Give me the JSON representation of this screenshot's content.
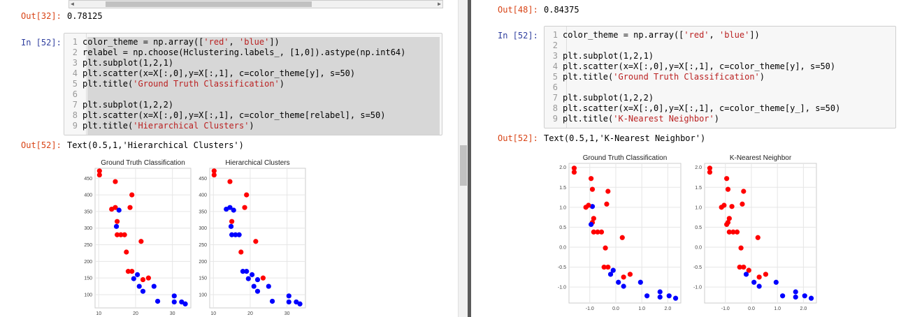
{
  "left": {
    "out32": {
      "prompt": "Out[32]:",
      "value": "0.78125"
    },
    "in52": {
      "prompt": "In [52]:",
      "lines": [
        {
          "n": "1",
          "code": "color_theme = np.array(['red', 'blue'])"
        },
        {
          "n": "2",
          "code": "relabel = np.choose(Hclustering.labels_, [1,0]).astype(np.int64)"
        },
        {
          "n": "3",
          "code": "plt.subplot(1,2,1)"
        },
        {
          "n": "4",
          "code": "plt.scatter(x=X[:,0],y=X[:,1], c=color_theme[y], s=50)"
        },
        {
          "n": "5",
          "code": "plt.title('Ground Truth Classification')"
        },
        {
          "n": "6",
          "code": ""
        },
        {
          "n": "7",
          "code": "plt.subplot(1,2,2)"
        },
        {
          "n": "8",
          "code": "plt.scatter(x=X[:,0],y=X[:,1], c=color_theme[relabel], s=50)"
        },
        {
          "n": "9",
          "code": "plt.title('Hierarchical Clusters')"
        }
      ]
    },
    "out52": {
      "prompt": "Out[52]:",
      "value": "Text(0.5,1,'Hierarchical Clusters')"
    }
  },
  "right": {
    "out48": {
      "prompt": "Out[48]:",
      "value": "0.84375"
    },
    "in52": {
      "prompt": "In [52]:",
      "lines": [
        {
          "n": "1",
          "code": "color_theme = np.array(['red', 'blue'])"
        },
        {
          "n": "2",
          "code": ""
        },
        {
          "n": "3",
          "code": "plt.subplot(1,2,1)"
        },
        {
          "n": "4",
          "code": "plt.scatter(x=X[:,0],y=X[:,1], c=color_theme[y], s=50)"
        },
        {
          "n": "5",
          "code": "plt.title('Ground Truth Classification')"
        },
        {
          "n": "6",
          "code": ""
        },
        {
          "n": "7",
          "code": "plt.subplot(1,2,2)"
        },
        {
          "n": "8",
          "code": "plt.scatter(x=X[:,0],y=X[:,1], c=color_theme[y_], s=50)"
        },
        {
          "n": "9",
          "code": "plt.title('K-Nearest Neighbor')"
        }
      ]
    },
    "out52": {
      "prompt": "Out[52]:",
      "value": "Text(0.5,1,'K-Nearest Neighbor')"
    }
  },
  "colors": {
    "red": "#ff0000",
    "blue": "#0000ff",
    "grid": "#e6e6e6"
  },
  "chart_data": [
    {
      "type": "scatter",
      "title": "Ground Truth Classification",
      "xlim": [
        9,
        35
      ],
      "ylim": [
        60,
        480
      ],
      "xticks": [
        10,
        20,
        30
      ],
      "yticks": [
        100,
        150,
        200,
        250,
        300,
        350,
        400,
        450
      ],
      "grid": true,
      "points": [
        {
          "x": 10.2,
          "y": 472,
          "c": "red"
        },
        {
          "x": 10.2,
          "y": 460,
          "c": "red"
        },
        {
          "x": 14.5,
          "y": 440,
          "c": "red"
        },
        {
          "x": 19,
          "y": 400,
          "c": "red"
        },
        {
          "x": 13.5,
          "y": 357,
          "c": "red"
        },
        {
          "x": 14.5,
          "y": 362,
          "c": "red"
        },
        {
          "x": 18.5,
          "y": 362,
          "c": "red"
        },
        {
          "x": 15.5,
          "y": 354,
          "c": "blue"
        },
        {
          "x": 15,
          "y": 320,
          "c": "red"
        },
        {
          "x": 14.8,
          "y": 305,
          "c": "blue"
        },
        {
          "x": 15,
          "y": 280,
          "c": "red"
        },
        {
          "x": 16,
          "y": 280,
          "c": "red"
        },
        {
          "x": 17,
          "y": 280,
          "c": "red"
        },
        {
          "x": 21.5,
          "y": 260,
          "c": "red"
        },
        {
          "x": 17.5,
          "y": 228,
          "c": "red"
        },
        {
          "x": 18,
          "y": 170,
          "c": "red"
        },
        {
          "x": 19,
          "y": 170,
          "c": "red"
        },
        {
          "x": 19.5,
          "y": 148,
          "c": "blue"
        },
        {
          "x": 20.5,
          "y": 160,
          "c": "blue"
        },
        {
          "x": 22,
          "y": 145,
          "c": "red"
        },
        {
          "x": 23.5,
          "y": 150,
          "c": "red"
        },
        {
          "x": 21,
          "y": 125,
          "c": "blue"
        },
        {
          "x": 22,
          "y": 110,
          "c": "blue"
        },
        {
          "x": 25,
          "y": 125,
          "c": "blue"
        },
        {
          "x": 26,
          "y": 80,
          "c": "blue"
        },
        {
          "x": 30.5,
          "y": 96,
          "c": "blue"
        },
        {
          "x": 30.5,
          "y": 78,
          "c": "blue"
        },
        {
          "x": 32.5,
          "y": 78,
          "c": "blue"
        },
        {
          "x": 33.5,
          "y": 72,
          "c": "blue"
        }
      ]
    },
    {
      "type": "scatter",
      "title": "Hierarchical Clusters",
      "xlim": [
        9,
        35
      ],
      "ylim": [
        60,
        480
      ],
      "xticks": [
        10,
        20,
        30
      ],
      "yticks": [
        100,
        150,
        200,
        250,
        300,
        350,
        400,
        450
      ],
      "grid": true,
      "points": [
        {
          "x": 10.2,
          "y": 472,
          "c": "red"
        },
        {
          "x": 10.2,
          "y": 460,
          "c": "red"
        },
        {
          "x": 14.5,
          "y": 440,
          "c": "red"
        },
        {
          "x": 19,
          "y": 400,
          "c": "red"
        },
        {
          "x": 13.5,
          "y": 357,
          "c": "blue"
        },
        {
          "x": 14.5,
          "y": 362,
          "c": "blue"
        },
        {
          "x": 18.5,
          "y": 362,
          "c": "red"
        },
        {
          "x": 15.5,
          "y": 354,
          "c": "blue"
        },
        {
          "x": 15,
          "y": 320,
          "c": "red"
        },
        {
          "x": 14.8,
          "y": 305,
          "c": "blue"
        },
        {
          "x": 15,
          "y": 280,
          "c": "blue"
        },
        {
          "x": 16,
          "y": 280,
          "c": "blue"
        },
        {
          "x": 17,
          "y": 280,
          "c": "blue"
        },
        {
          "x": 21.5,
          "y": 260,
          "c": "red"
        },
        {
          "x": 17.5,
          "y": 228,
          "c": "red"
        },
        {
          "x": 18,
          "y": 170,
          "c": "blue"
        },
        {
          "x": 19,
          "y": 170,
          "c": "blue"
        },
        {
          "x": 19.5,
          "y": 148,
          "c": "blue"
        },
        {
          "x": 20.5,
          "y": 160,
          "c": "blue"
        },
        {
          "x": 22,
          "y": 145,
          "c": "blue"
        },
        {
          "x": 23.5,
          "y": 150,
          "c": "red"
        },
        {
          "x": 21,
          "y": 125,
          "c": "blue"
        },
        {
          "x": 22,
          "y": 110,
          "c": "blue"
        },
        {
          "x": 25,
          "y": 125,
          "c": "blue"
        },
        {
          "x": 26,
          "y": 80,
          "c": "blue"
        },
        {
          "x": 30.5,
          "y": 96,
          "c": "blue"
        },
        {
          "x": 30.5,
          "y": 78,
          "c": "blue"
        },
        {
          "x": 32.5,
          "y": 78,
          "c": "blue"
        },
        {
          "x": 33.5,
          "y": 72,
          "c": "blue"
        }
      ]
    },
    {
      "type": "scatter",
      "title": "Ground Truth Classification",
      "xlim": [
        -1.8,
        2.5
      ],
      "ylim": [
        -1.4,
        2.1
      ],
      "xticks": [
        -1,
        0,
        1,
        2
      ],
      "yticks": [
        -1.0,
        -0.5,
        0.0,
        0.5,
        1.0,
        1.5,
        2.0
      ],
      "grid": true,
      "points": [
        {
          "x": -1.6,
          "y": 1.98,
          "c": "red"
        },
        {
          "x": -1.6,
          "y": 1.88,
          "c": "red"
        },
        {
          "x": -0.95,
          "y": 1.72,
          "c": "red"
        },
        {
          "x": -0.9,
          "y": 1.02,
          "c": "blue"
        },
        {
          "x": -0.9,
          "y": 1.45,
          "c": "red"
        },
        {
          "x": -0.3,
          "y": 1.4,
          "c": "red"
        },
        {
          "x": -0.35,
          "y": 1.08,
          "c": "red"
        },
        {
          "x": -1.15,
          "y": 1.0,
          "c": "red"
        },
        {
          "x": -1.05,
          "y": 1.05,
          "c": "red"
        },
        {
          "x": -0.85,
          "y": 0.72,
          "c": "red"
        },
        {
          "x": -0.9,
          "y": 0.62,
          "c": "red"
        },
        {
          "x": -0.95,
          "y": 0.57,
          "c": "blue"
        },
        {
          "x": -0.85,
          "y": 0.38,
          "c": "red"
        },
        {
          "x": -0.7,
          "y": 0.38,
          "c": "red"
        },
        {
          "x": -0.55,
          "y": 0.38,
          "c": "red"
        },
        {
          "x": 0.25,
          "y": 0.24,
          "c": "red"
        },
        {
          "x": -0.4,
          "y": -0.02,
          "c": "red"
        },
        {
          "x": -0.45,
          "y": -0.5,
          "c": "red"
        },
        {
          "x": -0.3,
          "y": -0.5,
          "c": "red"
        },
        {
          "x": -0.1,
          "y": -0.58,
          "c": "blue"
        },
        {
          "x": -0.2,
          "y": -0.68,
          "c": "blue"
        },
        {
          "x": 0.3,
          "y": -0.75,
          "c": "red"
        },
        {
          "x": 0.55,
          "y": -0.68,
          "c": "red"
        },
        {
          "x": 0.1,
          "y": -0.88,
          "c": "blue"
        },
        {
          "x": 0.3,
          "y": -0.98,
          "c": "blue"
        },
        {
          "x": 0.95,
          "y": -0.88,
          "c": "blue"
        },
        {
          "x": 1.2,
          "y": -1.22,
          "c": "blue"
        },
        {
          "x": 1.7,
          "y": -1.12,
          "c": "blue"
        },
        {
          "x": 1.7,
          "y": -1.25,
          "c": "blue"
        },
        {
          "x": 2.05,
          "y": -1.22,
          "c": "blue"
        },
        {
          "x": 2.3,
          "y": -1.28,
          "c": "blue"
        }
      ]
    },
    {
      "type": "scatter",
      "title": "K-Nearest Neighbor",
      "xlim": [
        -1.8,
        2.5
      ],
      "ylim": [
        -1.4,
        2.1
      ],
      "xticks": [
        -1,
        0,
        1,
        2
      ],
      "yticks": [
        -1.0,
        -0.5,
        0.0,
        0.5,
        1.0,
        1.5,
        2.0
      ],
      "grid": true,
      "points": [
        {
          "x": -1.6,
          "y": 1.98,
          "c": "red"
        },
        {
          "x": -1.6,
          "y": 1.88,
          "c": "red"
        },
        {
          "x": -0.95,
          "y": 1.72,
          "c": "red"
        },
        {
          "x": -0.75,
          "y": 1.02,
          "c": "red"
        },
        {
          "x": -0.9,
          "y": 1.45,
          "c": "red"
        },
        {
          "x": -0.3,
          "y": 1.4,
          "c": "red"
        },
        {
          "x": -0.35,
          "y": 1.08,
          "c": "red"
        },
        {
          "x": -1.15,
          "y": 1.0,
          "c": "red"
        },
        {
          "x": -1.05,
          "y": 1.05,
          "c": "red"
        },
        {
          "x": -0.85,
          "y": 0.72,
          "c": "red"
        },
        {
          "x": -0.9,
          "y": 0.62,
          "c": "red"
        },
        {
          "x": -0.95,
          "y": 0.57,
          "c": "red"
        },
        {
          "x": -0.85,
          "y": 0.38,
          "c": "red"
        },
        {
          "x": -0.7,
          "y": 0.38,
          "c": "red"
        },
        {
          "x": -0.55,
          "y": 0.38,
          "c": "red"
        },
        {
          "x": 0.25,
          "y": 0.24,
          "c": "red"
        },
        {
          "x": -0.4,
          "y": -0.02,
          "c": "red"
        },
        {
          "x": -0.45,
          "y": -0.5,
          "c": "red"
        },
        {
          "x": -0.3,
          "y": -0.5,
          "c": "red"
        },
        {
          "x": -0.1,
          "y": -0.58,
          "c": "red"
        },
        {
          "x": -0.2,
          "y": -0.68,
          "c": "blue"
        },
        {
          "x": 0.3,
          "y": -0.75,
          "c": "red"
        },
        {
          "x": 0.55,
          "y": -0.68,
          "c": "red"
        },
        {
          "x": 0.1,
          "y": -0.88,
          "c": "blue"
        },
        {
          "x": 0.3,
          "y": -0.98,
          "c": "blue"
        },
        {
          "x": 0.95,
          "y": -0.88,
          "c": "blue"
        },
        {
          "x": 1.2,
          "y": -1.22,
          "c": "blue"
        },
        {
          "x": 1.7,
          "y": -1.12,
          "c": "blue"
        },
        {
          "x": 1.7,
          "y": -1.25,
          "c": "blue"
        },
        {
          "x": 2.05,
          "y": -1.22,
          "c": "blue"
        },
        {
          "x": 2.3,
          "y": -1.28,
          "c": "blue"
        }
      ]
    }
  ]
}
